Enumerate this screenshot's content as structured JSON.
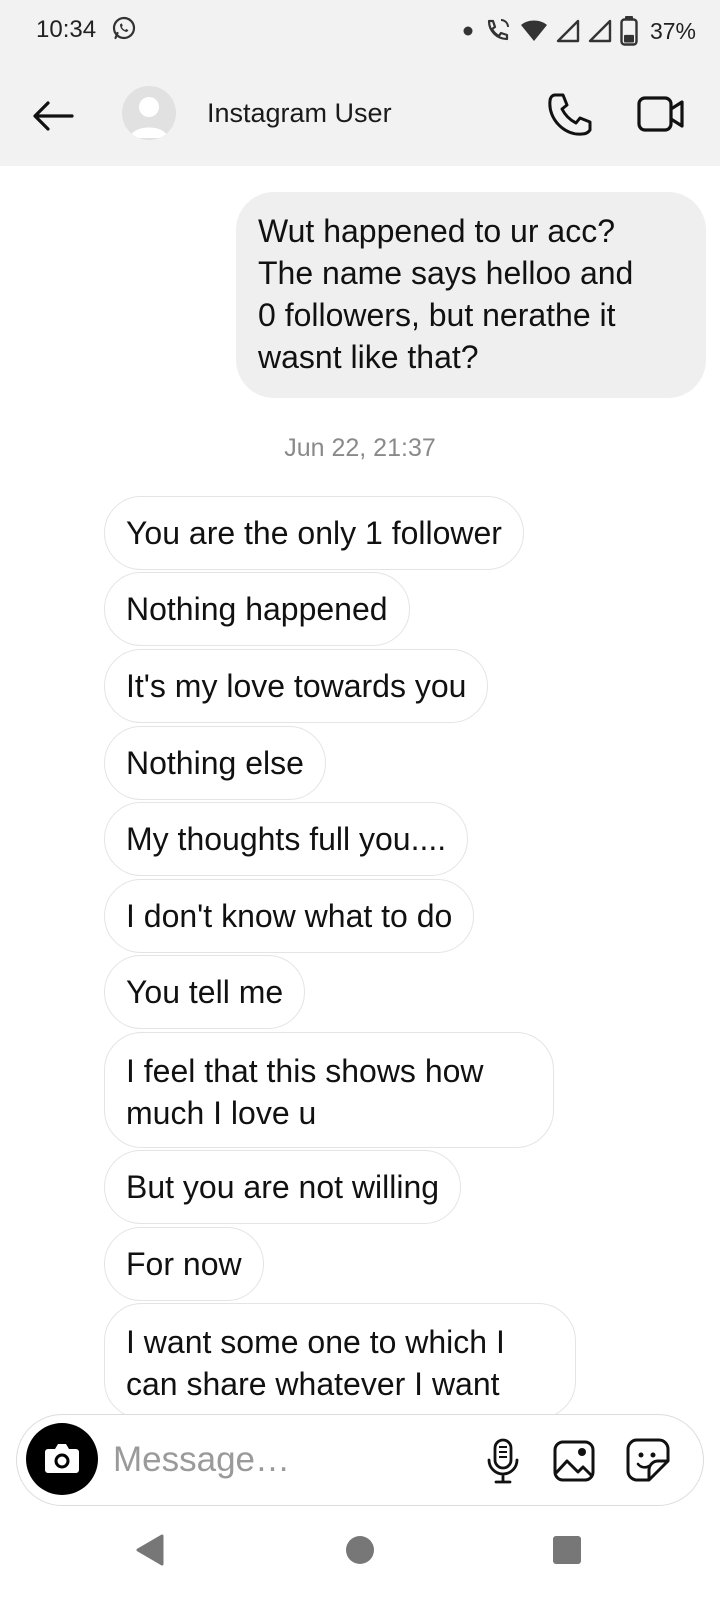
{
  "status_bar": {
    "time": "10:34",
    "battery_percent": "37%",
    "battery_level": 0.37,
    "icons": [
      "whatsapp-notification-icon",
      "dot-icon",
      "wifi-call-icon",
      "wifi-icon",
      "signal-icon",
      "signal-icon",
      "battery-icon"
    ]
  },
  "header": {
    "title": "Instagram User",
    "back_icon": "arrow-left-icon",
    "call_icon": "phone-icon",
    "video_icon": "video-camera-icon"
  },
  "messages": {
    "sent": [
      {
        "lines": [
          "Wut happened to ur acc?",
          "The name says helloo and",
          "0 followers, but nerathe it",
          "wasnt like that?"
        ]
      }
    ],
    "timestamp": "Jun 22, 21:37",
    "received": [
      {
        "lines": [
          "You are the only 1 follower"
        ]
      },
      {
        "lines": [
          "Nothing happened"
        ]
      },
      {
        "lines": [
          "It's my love towards you"
        ]
      },
      {
        "lines": [
          "Nothing else"
        ]
      },
      {
        "lines": [
          "My thoughts full you...."
        ]
      },
      {
        "lines": [
          "I don't know what to do"
        ]
      },
      {
        "lines": [
          "You tell me"
        ]
      },
      {
        "lines": [
          "I feel that this shows how",
          "much I love u"
        ]
      },
      {
        "lines": [
          "But you are not willing"
        ]
      },
      {
        "lines": [
          "For now"
        ]
      },
      {
        "lines": [
          "I want some one to which I",
          "can share whatever I want"
        ]
      }
    ]
  },
  "composer": {
    "placeholder": "Message…",
    "icons": [
      "camera-icon",
      "microphone-icon",
      "gallery-icon",
      "sticker-icon"
    ]
  },
  "nav_bar": {
    "icons": [
      "nav-back-icon",
      "nav-home-icon",
      "nav-recents-icon"
    ]
  },
  "colors": {
    "header_bg": "#f2f2f2",
    "sent_bubble_bg": "#efefef",
    "received_border": "#e4e4e4",
    "timestamp": "#8a8a8a",
    "placeholder": "#9a9a9a"
  }
}
